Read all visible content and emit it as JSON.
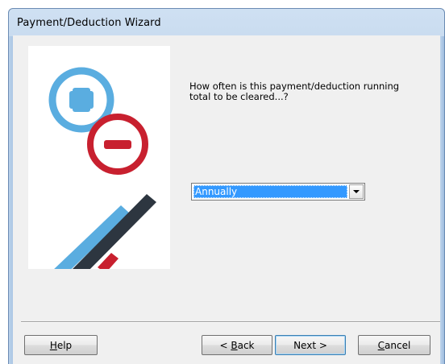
{
  "window": {
    "title": "Payment/Deduction Wizard"
  },
  "main": {
    "question": "How often is this payment/deduction running total to be cleared...?",
    "frequency_select": {
      "selected": "Annually"
    }
  },
  "buttons": {
    "help": {
      "mnemonic": "H",
      "rest": "elp"
    },
    "back": {
      "prefix": "< ",
      "mnemonic": "B",
      "rest": "ack"
    },
    "next": {
      "label": "Next >"
    },
    "cancel": {
      "mnemonic": "C",
      "rest": "ancel"
    }
  },
  "colors": {
    "plus_blue": "#5aade0",
    "minus_red": "#c8202f",
    "stripe_dark": "#2d3640",
    "selection": "#3399ff"
  }
}
